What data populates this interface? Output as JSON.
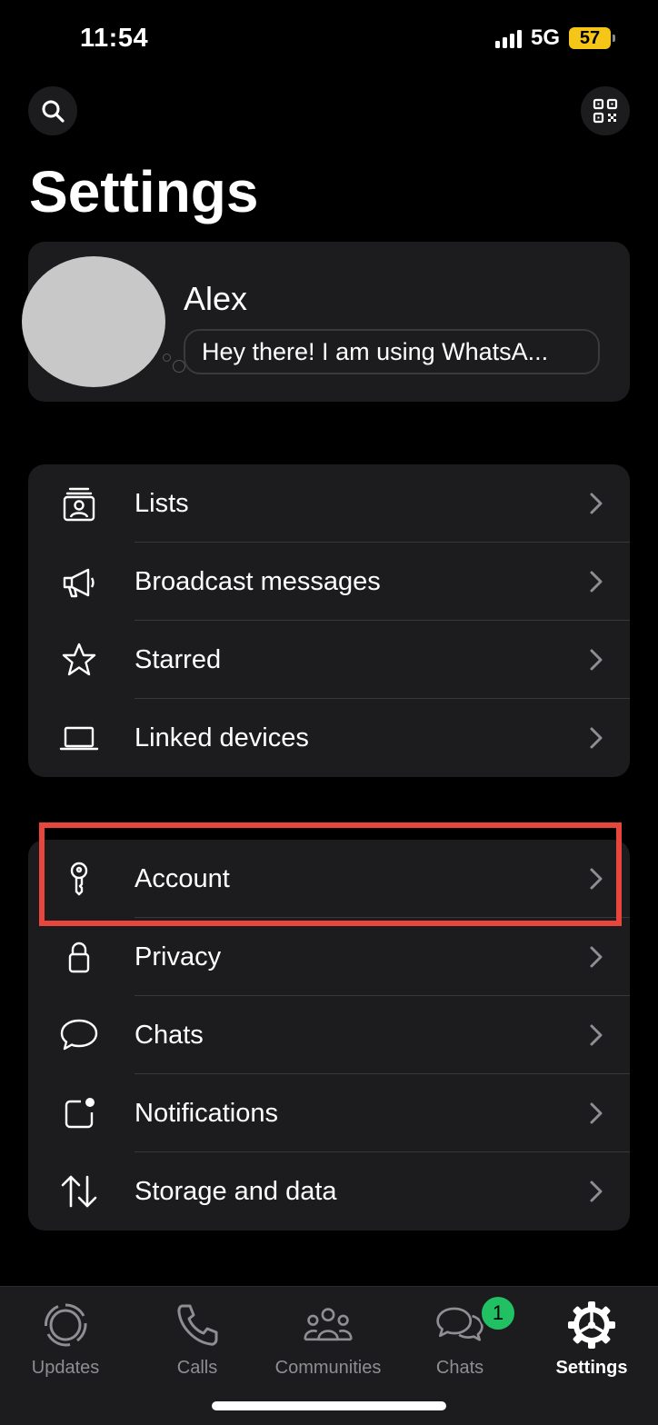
{
  "status_bar": {
    "time": "11:54",
    "network": "5G",
    "battery": "57",
    "battery_color": "#f5c518"
  },
  "header": {
    "title": "Settings",
    "search_icon": "search-icon",
    "qr_icon": "qr-code-icon"
  },
  "profile": {
    "name": "Alex",
    "status": "Hey there! I am using WhatsA..."
  },
  "groups": [
    [
      {
        "label": "Lists",
        "icon": "lists-icon"
      },
      {
        "label": "Broadcast messages",
        "icon": "megaphone-icon"
      },
      {
        "label": "Starred",
        "icon": "star-icon"
      },
      {
        "label": "Linked devices",
        "icon": "laptop-icon"
      }
    ],
    [
      {
        "label": "Account",
        "icon": "key-icon"
      },
      {
        "label": "Privacy",
        "icon": "lock-icon"
      },
      {
        "label": "Chats",
        "icon": "chat-bubble-icon"
      },
      {
        "label": "Notifications",
        "icon": "notification-icon"
      },
      {
        "label": "Storage and data",
        "icon": "storage-arrows-icon"
      }
    ]
  ],
  "highlight": {
    "target": "Account",
    "color": "#e8453c"
  },
  "tabbar": {
    "items": [
      {
        "label": "Updates",
        "icon": "updates-icon",
        "active": false
      },
      {
        "label": "Calls",
        "icon": "phone-icon",
        "active": false
      },
      {
        "label": "Communities",
        "icon": "communities-icon",
        "active": false
      },
      {
        "label": "Chats",
        "icon": "chats-tab-icon",
        "active": false
      },
      {
        "label": "Settings",
        "icon": "settings-gear-icon",
        "active": true
      }
    ],
    "chats_badge": "1",
    "badge_color": "#21c063"
  }
}
